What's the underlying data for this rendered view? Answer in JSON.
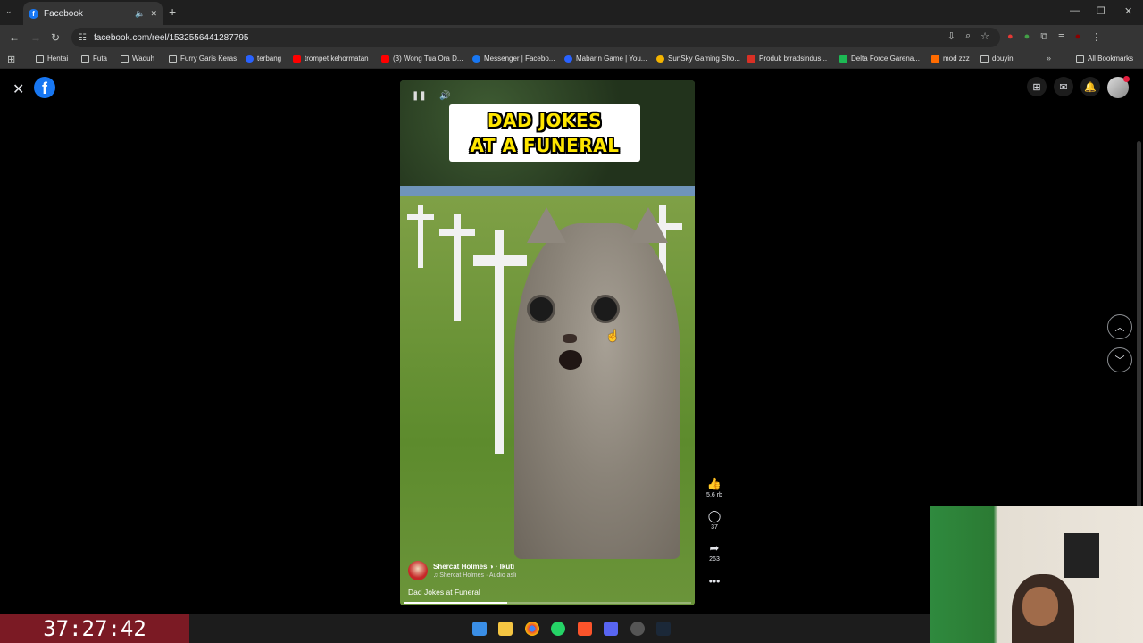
{
  "browser": {
    "tab_title": "Facebook",
    "url": "facebook.com/reel/1532556441287795"
  },
  "bookmarks": {
    "items": [
      {
        "label": "Hentai",
        "icon": "folder-icon"
      },
      {
        "label": "Futa",
        "icon": "folder-icon"
      },
      {
        "label": "Waduh",
        "icon": "folder-icon"
      },
      {
        "label": "Furry Garis Keras",
        "icon": "folder-icon"
      },
      {
        "label": "terbang",
        "icon": "site-icon"
      },
      {
        "label": "trompet kehormatan",
        "icon": "youtube-icon"
      },
      {
        "label": "(3) Wong Tua Ora D...",
        "icon": "youtube-icon"
      },
      {
        "label": "Messenger | Facebo...",
        "icon": "facebook-icon"
      },
      {
        "label": "Mabarin Game | You...",
        "icon": "site-icon"
      },
      {
        "label": "SunSky Gaming Sho...",
        "icon": "site-icon"
      },
      {
        "label": "Produk brradsindus...",
        "icon": "site-icon"
      },
      {
        "label": "Delta Force Garena...",
        "icon": "site-icon"
      },
      {
        "label": "mod zzz",
        "icon": "site-icon"
      },
      {
        "label": "douyin",
        "icon": "folder-icon"
      }
    ],
    "all_bookmarks": "All Bookmarks"
  },
  "reel": {
    "title_line1": "DAD JOKES",
    "title_line2": "AT A FUNERAL",
    "author": "Shercat Holmes",
    "follow": "Ikuti",
    "audio": "Shercat Holmes · Audio asli",
    "caption": "Dad Jokes at Funeral",
    "progress": 0.36,
    "likes": "5,6 rb",
    "comments": "37",
    "shares": "263"
  },
  "overlay": {
    "timer": "37:27:42"
  },
  "colors": {
    "facebook_blue": "#1877f2",
    "title_yellow": "#ffe600",
    "timer_red": "#7b1a24"
  }
}
